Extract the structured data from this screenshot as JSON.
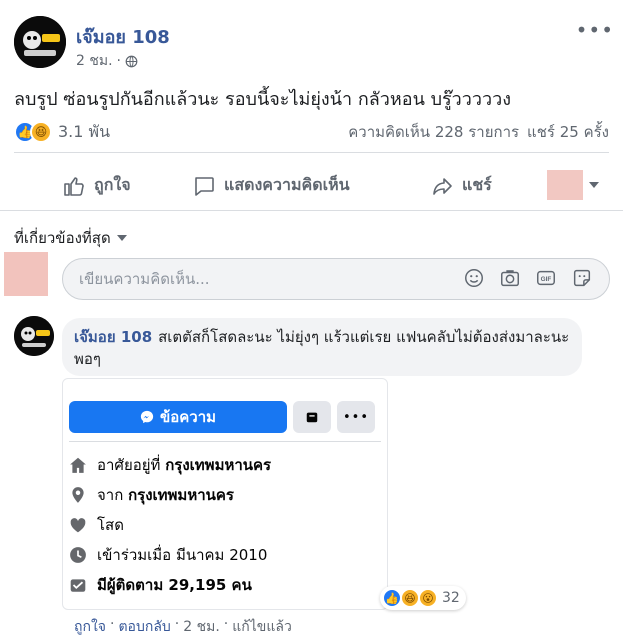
{
  "post": {
    "author": "เจ๊มอย 108",
    "time": "2 ชม.",
    "privacy_icon": "globe-icon",
    "text": "ลบรูป ซ่อนรูปกันอีกแล้วนะ รอบนี้จะไม่ยุ่งน้า กลัวหอน บรู๊วววววง",
    "more": "•••"
  },
  "stats": {
    "reaction_count": "3.1 พัน",
    "comments": "ความคิดเห็น 228 รายการ",
    "shares": "แชร์ 25 ครั้ง"
  },
  "actions": {
    "like": "ถูกใจ",
    "comment": "แสดงความคิดเห็น",
    "share": "แชร์"
  },
  "sort": {
    "label": "ที่เกี่ยวข้องที่สุด"
  },
  "comment_input": {
    "placeholder": "เขียนความคิดเห็น..."
  },
  "comment": {
    "author": "เจ๊มอย 108",
    "text": "สเตตัสก็โสดละนะ ไม่ยุ่งๆ แร้วแต่เรย แฟนคลับไม่ต้องส่งมาละนะ พอๆ",
    "reaction_count": "32",
    "actions": {
      "like": "ถูกใจ",
      "reply": "ตอบกลับ",
      "time": "2 ชม.",
      "edited": "แก้ไขแล้ว",
      "sep": "·"
    }
  },
  "screenshot": {
    "message_button": "ข้อความ",
    "rows": [
      {
        "icon": "home-icon",
        "prefix": "อาศัยอยู่ที่ ",
        "value": "กรุงเทพมหานคร"
      },
      {
        "icon": "location-pin-icon",
        "prefix": "จาก ",
        "value": "กรุงเทพมหานคร"
      },
      {
        "icon": "heart-icon",
        "prefix": "โสด",
        "value": ""
      },
      {
        "icon": "clock-icon",
        "prefix": "เข้าร่วมเมื่อ มีนาคม 2010",
        "value": ""
      },
      {
        "icon": "followers-icon",
        "prefix": "มีผู้ติดตาม 29,195 คน",
        "value": ""
      }
    ]
  },
  "colors": {
    "link": "#385898",
    "primary": "#1877f2",
    "muted": "#606770"
  }
}
